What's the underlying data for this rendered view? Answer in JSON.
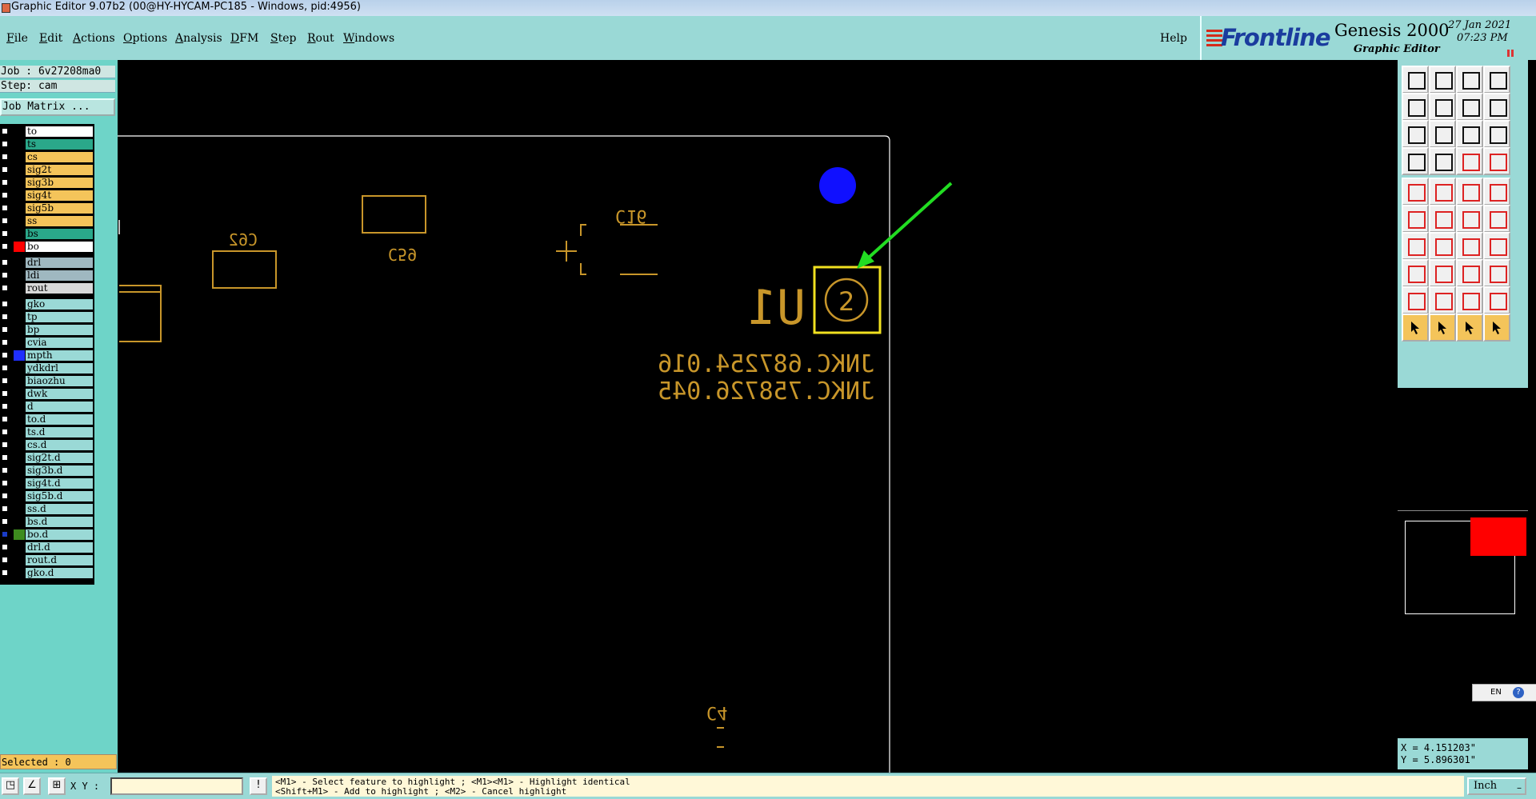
{
  "window": {
    "title": "Graphic Editor 9.07b2 (00@HY-HYCAM-PC185 - Windows, pid:4956)"
  },
  "menu": {
    "items": [
      "File",
      "Edit",
      "Actions",
      "Options",
      "Analysis",
      "DFM",
      "Step",
      "Rout",
      "Windows"
    ],
    "help": "Help"
  },
  "logo": {
    "brand": "Frontline",
    "product": "Genesis 2000",
    "subtitle": "Graphic Editor",
    "date": "27  Jan  2021",
    "time": "07:23  PM"
  },
  "job": {
    "job_line": "Job : 6v27208ma0",
    "step_line": "Step: cam",
    "matrix_button": "Job Matrix ..."
  },
  "layers": [
    {
      "name": "to",
      "color": "#ffffff"
    },
    {
      "name": "ts",
      "color": "#2aa88a"
    },
    {
      "name": "cs",
      "color": "#f4c45a"
    },
    {
      "name": "sig2t",
      "color": "#f4c45a"
    },
    {
      "name": "sig3b",
      "color": "#f4c45a"
    },
    {
      "name": "sig4t",
      "color": "#f4c45a"
    },
    {
      "name": "sig5b",
      "color": "#f4c45a"
    },
    {
      "name": "ss",
      "color": "#f4c45a"
    },
    {
      "name": "bs",
      "color": "#2aa88a"
    },
    {
      "name": "bo",
      "color": "#ffffff",
      "swatch": "#ff0000"
    },
    {
      "name": "drl",
      "color": "#9fb8c0",
      "gap": true
    },
    {
      "name": "ldi",
      "color": "#9fb8c0"
    },
    {
      "name": "rout",
      "color": "#d8d8d8"
    },
    {
      "name": "gko",
      "color": "#9ad9d6",
      "gap": true
    },
    {
      "name": "tp",
      "color": "#9ad9d6"
    },
    {
      "name": "bp",
      "color": "#9ad9d6"
    },
    {
      "name": "cvia",
      "color": "#9ad9d6"
    },
    {
      "name": "mpth",
      "color": "#9ad9d6",
      "swatch": "#1f2fff"
    },
    {
      "name": "ydkdrl",
      "color": "#9ad9d6"
    },
    {
      "name": "biaozhu",
      "color": "#9ad9d6"
    },
    {
      "name": "dwk",
      "color": "#9ad9d6"
    },
    {
      "name": "d",
      "color": "#9ad9d6"
    },
    {
      "name": "to.d",
      "color": "#9ad9d6"
    },
    {
      "name": "ts.d",
      "color": "#9ad9d6"
    },
    {
      "name": "cs.d",
      "color": "#9ad9d6"
    },
    {
      "name": "sig2t.d",
      "color": "#9ad9d6"
    },
    {
      "name": "sig3b.d",
      "color": "#9ad9d6"
    },
    {
      "name": "sig4t.d",
      "color": "#9ad9d6"
    },
    {
      "name": "sig5b.d",
      "color": "#9ad9d6"
    },
    {
      "name": "ss.d",
      "color": "#9ad9d6"
    },
    {
      "name": "bs.d",
      "color": "#9ad9d6"
    },
    {
      "name": "bo.d",
      "color": "#9ad9d6",
      "swatch": "#3d8c1e",
      "checkbox": "#1a3cc8"
    },
    {
      "name": "drl.d",
      "color": "#9ad9d6"
    },
    {
      "name": "rout.d",
      "color": "#9ad9d6"
    },
    {
      "name": "gko.d",
      "color": "#9ad9d6"
    }
  ],
  "selected": "Selected : 0",
  "canvas": {
    "labels": {
      "c62": "C62",
      "c59": "C59",
      "c16": "C16",
      "u1": "U1",
      "circle_num": "2",
      "text1": "JNKC.687254.016",
      "text2": "JNKC.758726.045",
      "c4": "C4"
    },
    "colors": {
      "feature": "#c8962a",
      "highlight": "#f0e020",
      "arrow": "#22dd22",
      "dot": "#1010ff",
      "outline": "#ffffff"
    }
  },
  "coords": {
    "x": "X = 4.151203\"",
    "y": "Y = 5.896301\""
  },
  "lang": {
    "code": "EN",
    "help": "?"
  },
  "status": {
    "xy_label": "X Y :",
    "xy_value": "",
    "hint_line1": "<M1> - Select feature to highlight ; <M1><M1> - Highlight identical",
    "hint_line2": "<Shift+M1> - Add to highlight ; <M2> - Cancel highlight",
    "unit": "Inch"
  }
}
